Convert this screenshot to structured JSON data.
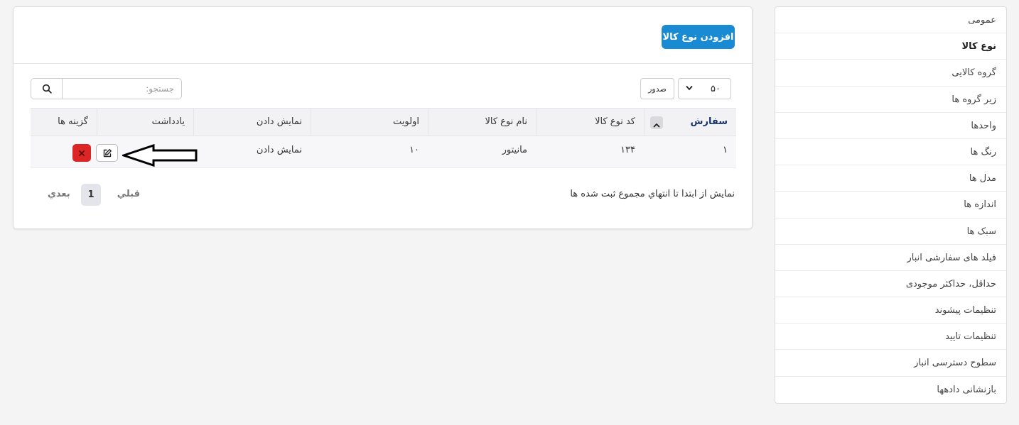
{
  "sidebar": {
    "items": [
      {
        "label": "عمومی"
      },
      {
        "label": "نوع کالا"
      },
      {
        "label": "گروه کالایی"
      },
      {
        "label": "زیر گروه ها"
      },
      {
        "label": "واحدها"
      },
      {
        "label": "رنگ ها"
      },
      {
        "label": "مدل ها"
      },
      {
        "label": "اندازه ها"
      },
      {
        "label": "سبک ها"
      },
      {
        "label": "فیلد های سفارشی انبار"
      },
      {
        "label": "حداقل، حداکثر موجودی"
      },
      {
        "label": "تنظیمات پیشوند"
      },
      {
        "label": "تنظیمات تایید"
      },
      {
        "label": "سطوح دسترسی انبار"
      },
      {
        "label": "بازنشانی دادهها"
      }
    ],
    "active_item": "نوع کالا"
  },
  "header": {
    "add_button_label": "افزودن نوع کالا"
  },
  "toolbar": {
    "rows_per_page": "۵۰",
    "export_label": "صدور",
    "search_placeholder": "جستجو:",
    "search_value": ""
  },
  "table": {
    "columns": [
      "سفارش",
      "کد نوع کالا",
      "نام نوع کالا",
      "اولویت",
      "نمایش دادن",
      "یادداشت",
      "گزینه ها"
    ],
    "rows": [
      {
        "order": "۱",
        "code": "۱۳۴",
        "name": "مانیتور",
        "priority": "۱۰",
        "display": "نمایش دادن",
        "note": ""
      }
    ]
  },
  "footer": {
    "info": "نمایش از ابتدا تا انتهاي مجموع ثبت شده ها",
    "prev_label": "قبلي",
    "current_page": "1",
    "next_label": "بعدي"
  },
  "colors": {
    "primary": "#1a8ad2",
    "danger": "#dc2626",
    "sort_header_text": "#16336a"
  }
}
